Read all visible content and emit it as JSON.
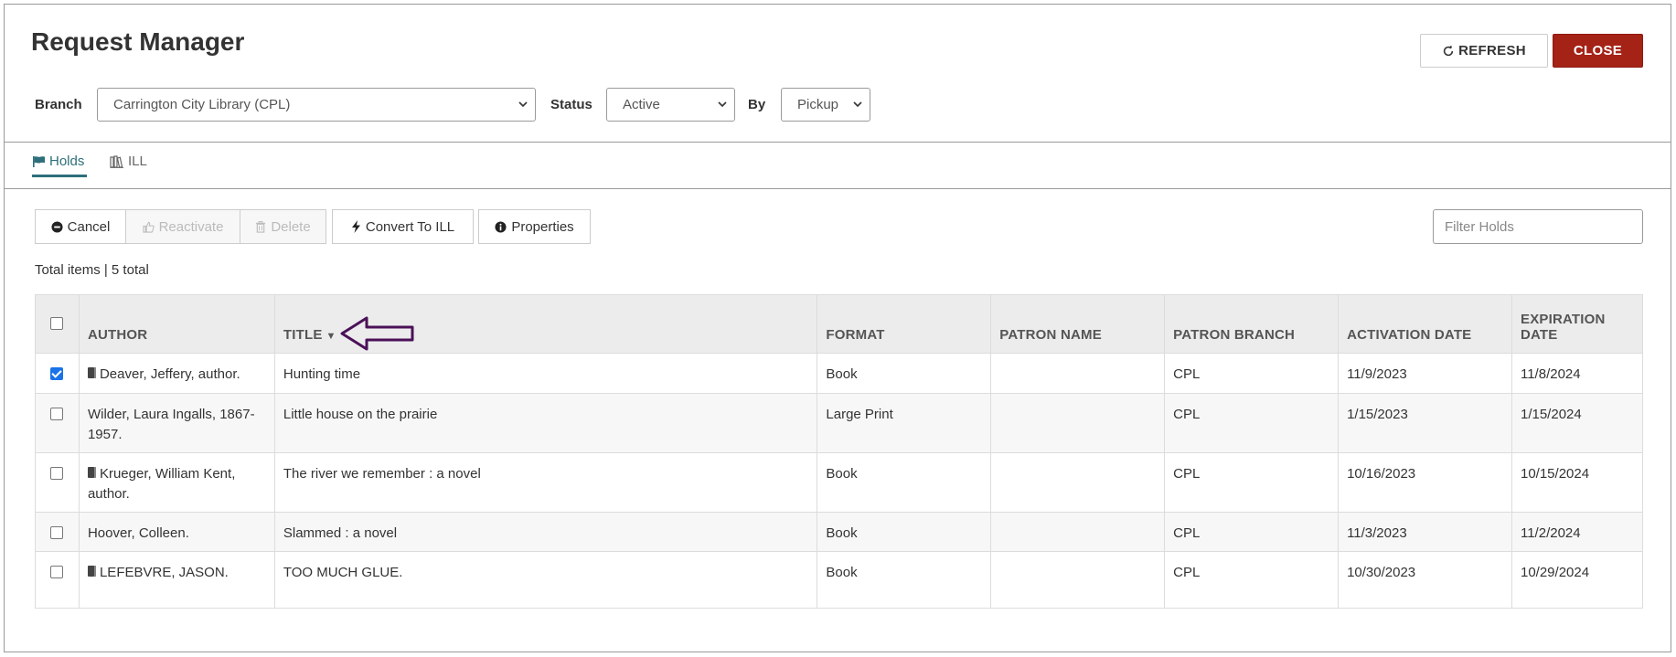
{
  "window": {
    "title": "Request Manager"
  },
  "header": {
    "refresh_label": "REFRESH",
    "close_label": "CLOSE",
    "close_color": "#a52216"
  },
  "filters": {
    "branch_label": "Branch",
    "branch_value": "Carrington City Library (CPL)",
    "status_label": "Status",
    "status_value": "Active",
    "by_label": "By",
    "by_value": "Pickup"
  },
  "tabs": [
    {
      "label": "Holds",
      "icon": "flag-icon",
      "active": true,
      "color": "#2d6f7a"
    },
    {
      "label": "ILL",
      "icon": "books-icon",
      "active": false
    }
  ],
  "toolbar": {
    "cancel_label": "Cancel",
    "reactivate_label": "Reactivate",
    "delete_label": "Delete",
    "convert_label": "Convert To ILL",
    "properties_label": "Properties",
    "filter_placeholder": "Filter Holds"
  },
  "summary": {
    "text": "Total items | 5 total"
  },
  "table": {
    "columns": [
      "AUTHOR",
      "TITLE",
      "FORMAT",
      "PATRON NAME",
      "PATRON BRANCH",
      "ACTIVATION DATE",
      "EXPIRATION DATE"
    ],
    "sort_column": "TITLE",
    "rows": [
      {
        "checked": true,
        "book_icon": true,
        "author": "Deaver, Jeffery, author.",
        "title": "Hunting time",
        "format": "Book",
        "patron_name": "",
        "patron_branch": "CPL",
        "activation": "11/9/2023",
        "expiration": "11/8/2024"
      },
      {
        "checked": false,
        "book_icon": false,
        "author": "Wilder, Laura Ingalls, 1867-1957.",
        "title": "Little house on the prairie",
        "format": "Large Print",
        "patron_name": "",
        "patron_branch": "CPL",
        "activation": "1/15/2023",
        "expiration": "1/15/2024"
      },
      {
        "checked": false,
        "book_icon": true,
        "author": "Krueger, William Kent, author.",
        "title": "The river we remember : a novel",
        "format": "Book",
        "patron_name": "",
        "patron_branch": "CPL",
        "activation": "10/16/2023",
        "expiration": "10/15/2024"
      },
      {
        "checked": false,
        "book_icon": false,
        "author": "Hoover, Colleen.",
        "title": "Slammed : a novel",
        "format": "Book",
        "patron_name": "",
        "patron_branch": "CPL",
        "activation": "11/3/2023",
        "expiration": "11/2/2024"
      },
      {
        "checked": false,
        "book_icon": true,
        "author": "LEFEBVRE, JASON.",
        "title": "TOO MUCH GLUE.",
        "format": "Book",
        "patron_name": "",
        "patron_branch": "CPL",
        "activation": "10/30/2023",
        "expiration": "10/29/2024"
      }
    ]
  },
  "annotation": {
    "icon": "arrow-left-outline-icon",
    "color": "#4b1158"
  }
}
